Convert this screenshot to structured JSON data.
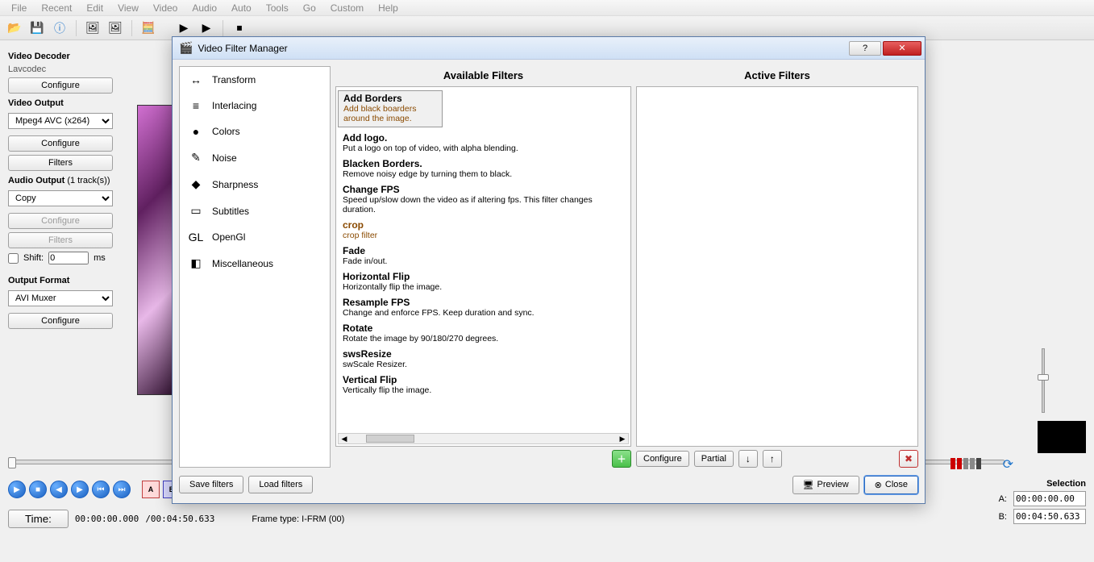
{
  "menu": [
    "File",
    "Recent",
    "Edit",
    "View",
    "Video",
    "Audio",
    "Auto",
    "Tools",
    "Go",
    "Custom",
    "Help"
  ],
  "left": {
    "decoder_title": "Video Decoder",
    "decoder_name": "Lavcodec",
    "configure": "Configure",
    "output_title": "Video Output",
    "output_codec": "Mpeg4 AVC (x264)",
    "filters": "Filters",
    "audio_title": "Audio Output",
    "audio_tracks": "(1 track(s))",
    "audio_mode": "Copy",
    "shift_label": "Shift:",
    "shift_value": "0",
    "shift_unit": "ms",
    "format_title": "Output Format",
    "format_sel": "AVI Muxer"
  },
  "status": {
    "time_label": "Time:",
    "time_value": "00:00:00.000",
    "duration": "/00:04:50.633",
    "frame_type": "Frame type: I-FRM (00)",
    "sel_label": "Selection",
    "a_label": "A:",
    "a_value": "00:00:00.00",
    "b_label": "B:",
    "b_value": "00:04:50.633"
  },
  "dialog": {
    "title": "Video Filter Manager",
    "avail_header": "Available Filters",
    "active_header": "Active Filters",
    "categories": [
      {
        "icon": "↔",
        "label": "Transform"
      },
      {
        "icon": "≡",
        "label": "Interlacing"
      },
      {
        "icon": "●",
        "label": "Colors"
      },
      {
        "icon": "✎",
        "label": "Noise"
      },
      {
        "icon": "◆",
        "label": "Sharpness"
      },
      {
        "icon": "▭",
        "label": "Subtitles"
      },
      {
        "icon": "GL",
        "label": "OpenGl"
      },
      {
        "icon": "◧",
        "label": "Miscellaneous"
      }
    ],
    "filters": [
      {
        "name": "Add Borders",
        "desc": "Add black boarders around the image."
      },
      {
        "name": "Add logo.",
        "desc": "Put a logo on top of video, with alpha blending."
      },
      {
        "name": "Blacken Borders.",
        "desc": "Remove noisy edge by turning them to black."
      },
      {
        "name": "Change FPS",
        "desc": "Speed up/slow down the video as if altering fps. This filter changes duration."
      },
      {
        "name": "crop",
        "desc": "crop filter"
      },
      {
        "name": "Fade",
        "desc": "Fade in/out."
      },
      {
        "name": "Horizontal Flip",
        "desc": "Horizontally flip the image."
      },
      {
        "name": "Resample FPS",
        "desc": "Change and enforce FPS. Keep duration and sync."
      },
      {
        "name": "Rotate",
        "desc": "Rotate the image by 90/180/270 degrees."
      },
      {
        "name": "swsResize",
        "desc": "swScale Resizer."
      },
      {
        "name": "Vertical Flip",
        "desc": "Vertically flip the image."
      }
    ],
    "btn_configure": "Configure",
    "btn_partial": "Partial",
    "btn_save": "Save filters",
    "btn_load": "Load filters",
    "btn_preview": "Preview",
    "btn_close": "Close"
  }
}
